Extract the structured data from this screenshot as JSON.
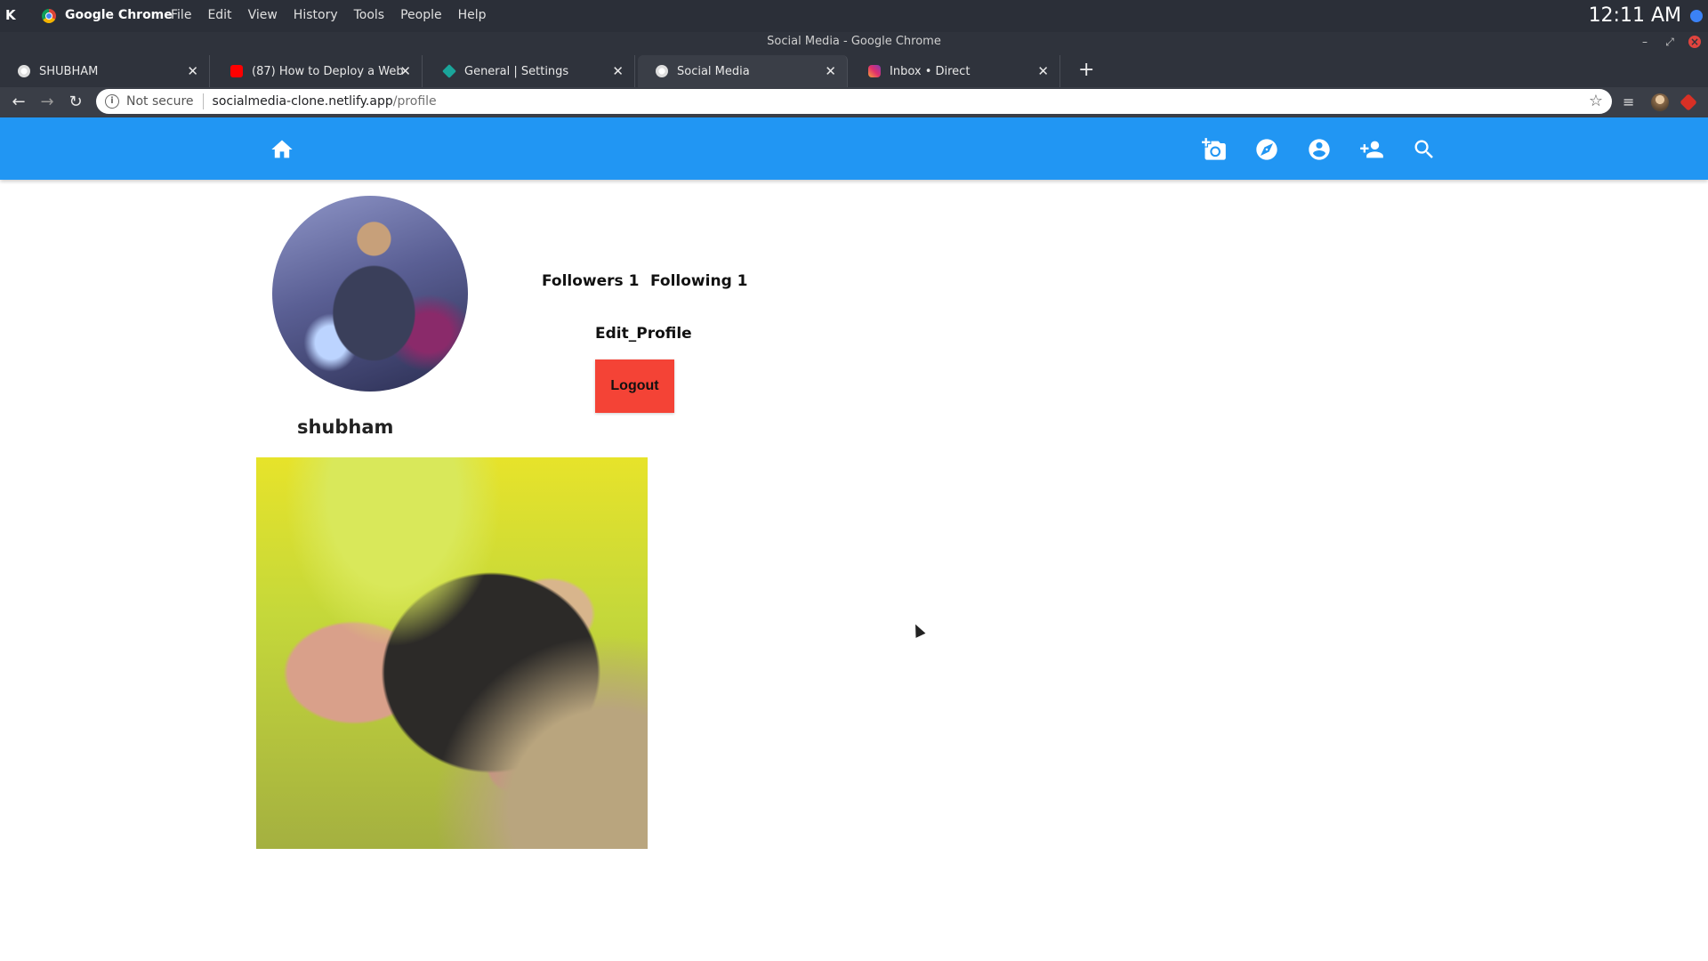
{
  "os": {
    "app_name": "Google Chrome",
    "menu": [
      "File",
      "Edit",
      "View",
      "History",
      "Tools",
      "People",
      "Help"
    ],
    "clock": "12:11 AM"
  },
  "window": {
    "title": "Social Media - Google Chrome"
  },
  "tabs": [
    {
      "label": "SHUBHAM",
      "icon": "globe-icon"
    },
    {
      "label": "(87) How to Deploy a Webpage",
      "icon": "youtube-icon"
    },
    {
      "label": "General | Settings",
      "icon": "diamond-icon"
    },
    {
      "label": "Social Media",
      "icon": "globe-icon",
      "active": true
    },
    {
      "label": "Inbox • Direct",
      "icon": "instagram-icon"
    }
  ],
  "omnibox": {
    "security": "Not secure",
    "host": "socialmedia-clone.netlify.app",
    "path": "/profile"
  },
  "app_nav": {
    "icons": [
      "home-icon",
      "add-photo-icon",
      "explore-icon",
      "account-icon",
      "person-add-icon",
      "search-icon"
    ],
    "color": "#2196f3"
  },
  "profile": {
    "username": "shubham",
    "followers": "Followers 1",
    "following": "Following 1",
    "edit_label": "Edit_Profile",
    "logout_label": "Logout",
    "logout_color": "#f44336"
  }
}
